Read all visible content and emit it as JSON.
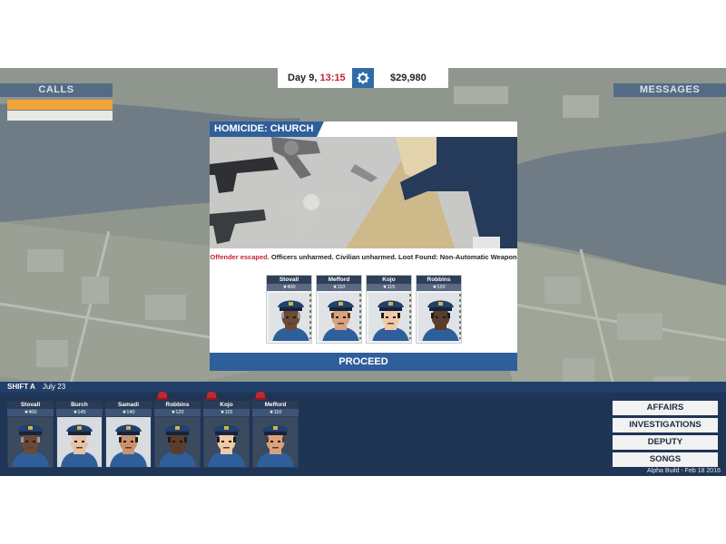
{
  "hud": {
    "day_label": "Day 9,",
    "time": "13:15",
    "money": "$29,980",
    "icon": "gear-icon"
  },
  "panels": {
    "calls": "CALLS",
    "messages": "MESSAGES"
  },
  "calls": [
    {
      "label": "",
      "highlight": true
    },
    {
      "label": "",
      "highlight": false
    }
  ],
  "dialog": {
    "title": "HOMICIDE: CHURCH",
    "outcome_escaped": "Offender escaped.",
    "outcome_rest": "Officers unharmed.  Civilian unharmed.  Loot Found: Non-Automatic Weapon",
    "proceed": "PROCEED",
    "officers": [
      {
        "name": "Stovall",
        "stars": "★400",
        "skin": "#6b4a36",
        "hair": "#9a9a9a"
      },
      {
        "name": "Mefford",
        "stars": "★110",
        "skin": "#d9a27c",
        "hair": "#5a3a20"
      },
      {
        "name": "Kojo",
        "stars": "★115",
        "skin": "#f0c9a6",
        "hair": "#1c1c1c"
      },
      {
        "name": "Robbins",
        "stars": "★120",
        "skin": "#5b3d2b",
        "hair": "#1c1c1c"
      }
    ]
  },
  "shift": {
    "label": "SHIFT A",
    "date": "July 23",
    "officers": [
      {
        "name": "Stovall",
        "stars": "★400",
        "skin": "#6b4a36",
        "hair": "#9a9a9a",
        "busy": false,
        "bg": "#3b4a5e"
      },
      {
        "name": "Burch",
        "stars": "★145",
        "skin": "#e6c2a4",
        "hair": "#d9d9d9",
        "busy": false,
        "bg": "#d8dbdf"
      },
      {
        "name": "Samadi",
        "stars": "★140",
        "skin": "#c9926c",
        "hair": "#2b1c14",
        "busy": false,
        "bg": "#d8dbdf"
      },
      {
        "name": "Robbins",
        "stars": "★120",
        "skin": "#5b3d2b",
        "hair": "#1c1c1c",
        "busy": true,
        "bg": "#3b4a5e"
      },
      {
        "name": "Kojo",
        "stars": "★115",
        "skin": "#f0c9a6",
        "hair": "#1c1c1c",
        "busy": true,
        "bg": "#3b4a5e"
      },
      {
        "name": "Mefford",
        "stars": "★110",
        "skin": "#d9a27c",
        "hair": "#5a3a20",
        "busy": true,
        "bg": "#3b4a5e"
      }
    ]
  },
  "menu": [
    "AFFAIRS",
    "INVESTIGATIONS",
    "DEPUTY",
    "SONGS"
  ],
  "build": "Alpha Build - Feb 18 2016"
}
